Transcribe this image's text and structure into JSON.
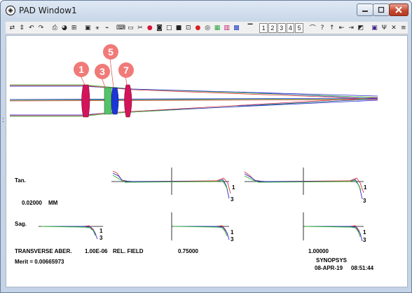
{
  "window": {
    "title": "PAD Window1"
  },
  "toolbar": {
    "page_numbers": [
      "1",
      "2",
      "3",
      "4",
      "5"
    ]
  },
  "lens_markers": [
    {
      "label": "1",
      "color": "#f07a78"
    },
    {
      "label": "3",
      "color": "#f07a78"
    },
    {
      "label": "5",
      "color": "#f07a78"
    },
    {
      "label": "7",
      "color": "#f07a78"
    }
  ],
  "plot": {
    "tan_label": "Tan.",
    "sag_label": "Sag.",
    "scale_value": "0.02000",
    "scale_unit": "MM",
    "curve_label_1": "1",
    "curve_label_3": "3",
    "footer_title": "TRANSVERSE ABER.",
    "footer_value": "1.00E-06",
    "footer_field": "REL. FIELD",
    "field_mid": "0.75000",
    "field_max": "1.00000",
    "merit": "Merit = 0.00665973",
    "brand": "SYNOPSYS",
    "date": "08-APR-19",
    "time": "08:51:44"
  },
  "colors": {
    "ray_green": "#2bb52b",
    "ray_blue": "#2a2ad8",
    "ray_red": "#d83a3a",
    "lens_magenta": "#d4145a",
    "lens_green": "#53c36a",
    "lens_blue": "#1c36d6",
    "close_button": "#c4452d"
  }
}
